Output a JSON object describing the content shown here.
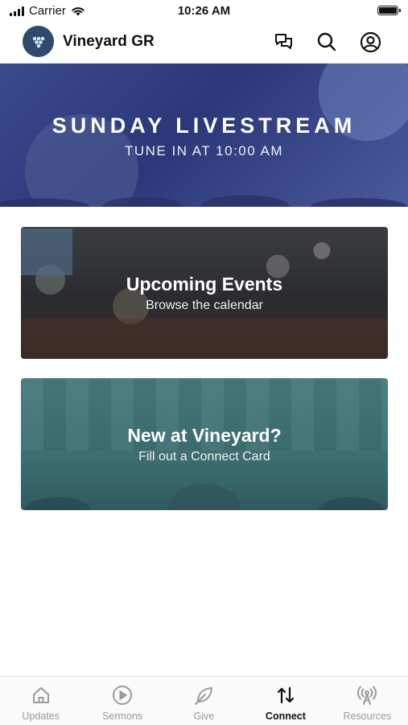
{
  "status_bar": {
    "carrier": "Carrier",
    "time": "10:26 AM"
  },
  "header": {
    "title": "Vineyard GR"
  },
  "banner": {
    "title": "SUNDAY LIVESTREAM",
    "subtitle": "TUNE IN AT 10:00 AM"
  },
  "cards": [
    {
      "title": "Upcoming Events",
      "subtitle": "Browse the calendar"
    },
    {
      "title": "New at Vineyard?",
      "subtitle": "Fill out a Connect Card"
    }
  ],
  "tabs": [
    {
      "label": "Updates",
      "icon": "home-icon"
    },
    {
      "label": "Sermons",
      "icon": "play-circle-icon"
    },
    {
      "label": "Give",
      "icon": "leaf-icon"
    },
    {
      "label": "Connect",
      "icon": "arrows-updown-icon",
      "active": true
    },
    {
      "label": "Resources",
      "icon": "broadcast-icon"
    }
  ],
  "colors": {
    "accent": "#111111",
    "inactive_tab": "#9a9a9a",
    "logo_bg": "#2e4a6d"
  }
}
